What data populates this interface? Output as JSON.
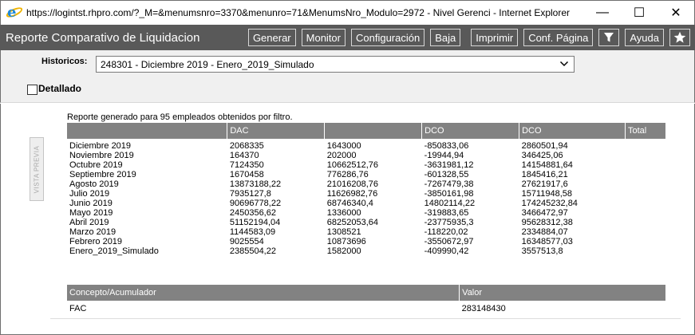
{
  "window": {
    "title": "https://logintst.rhpro.com/?_M=&menumsnro=3370&menunro=71&MenumsNro_Modulo=2972 - Nivel Gerenci - Internet Explorer",
    "minimize": "—",
    "maximize": "☐",
    "close": "✕"
  },
  "toolbar": {
    "title": "Reporte Comparativo de Liquidacion",
    "buttons": [
      "Generar",
      "Monitor",
      "Configuración",
      "Baja",
      "Imprimir",
      "Conf. Página",
      "Ayuda"
    ]
  },
  "filters": {
    "historicos_label": "Historicos:",
    "historicos_value": "248301 - Diciembre 2019 - Enero_2019_Simulado",
    "detallado_label": "Detallado"
  },
  "vista_previa": "VISTA PREVIA",
  "report": {
    "summary": "Reporte generado para 95 empleados obtenidos por filtro.",
    "headers": [
      "",
      "DAC",
      "",
      "DCO",
      "DCO",
      "Total"
    ],
    "rows": [
      [
        "Diciembre 2019",
        "2068335",
        "1643000",
        "-850833,06",
        "2860501,94",
        ""
      ],
      [
        "Noviembre 2019",
        "164370",
        "202000",
        "-19944,94",
        "346425,06",
        ""
      ],
      [
        "Octubre 2019",
        "7124350",
        "10662512,76",
        "-3631981,12",
        "14154881,64",
        ""
      ],
      [
        "Septiembre 2019",
        "1670458",
        "776286,76",
        "-601328,55",
        "1845416,21",
        ""
      ],
      [
        "Agosto 2019",
        "13873188,22",
        "21016208,76",
        "-7267479,38",
        "27621917,6",
        ""
      ],
      [
        "Julio 2019",
        "7935127,8",
        "11626982,76",
        "-3850161,98",
        "15711948,58",
        ""
      ],
      [
        "Junio 2019",
        "90696778,22",
        "68746340,4",
        "14802114,22",
        "174245232,84",
        ""
      ],
      [
        "Mayo 2019",
        "2450356,62",
        "1336000",
        "-319883,65",
        "3466472,97",
        ""
      ],
      [
        "Abril 2019",
        "51152194,04",
        "68252053,64",
        "-23775935,3",
        "95628312,38",
        ""
      ],
      [
        "Marzo 2019",
        "1144583,09",
        "1308521",
        "-118220,02",
        "2334884,07",
        ""
      ],
      [
        "Febrero 2019",
        "9025554",
        "10873696",
        "-3550672,97",
        "16348577,03",
        ""
      ],
      [
        "Enero_2019_Simulado",
        "2385504,22",
        "1582000",
        "-409990,42",
        "3557513,8",
        ""
      ]
    ],
    "concepto_headers": [
      "Concepto/Acumulador",
      "Valor"
    ],
    "concepto_rows": [
      [
        "FAC",
        "283148430"
      ]
    ]
  }
}
